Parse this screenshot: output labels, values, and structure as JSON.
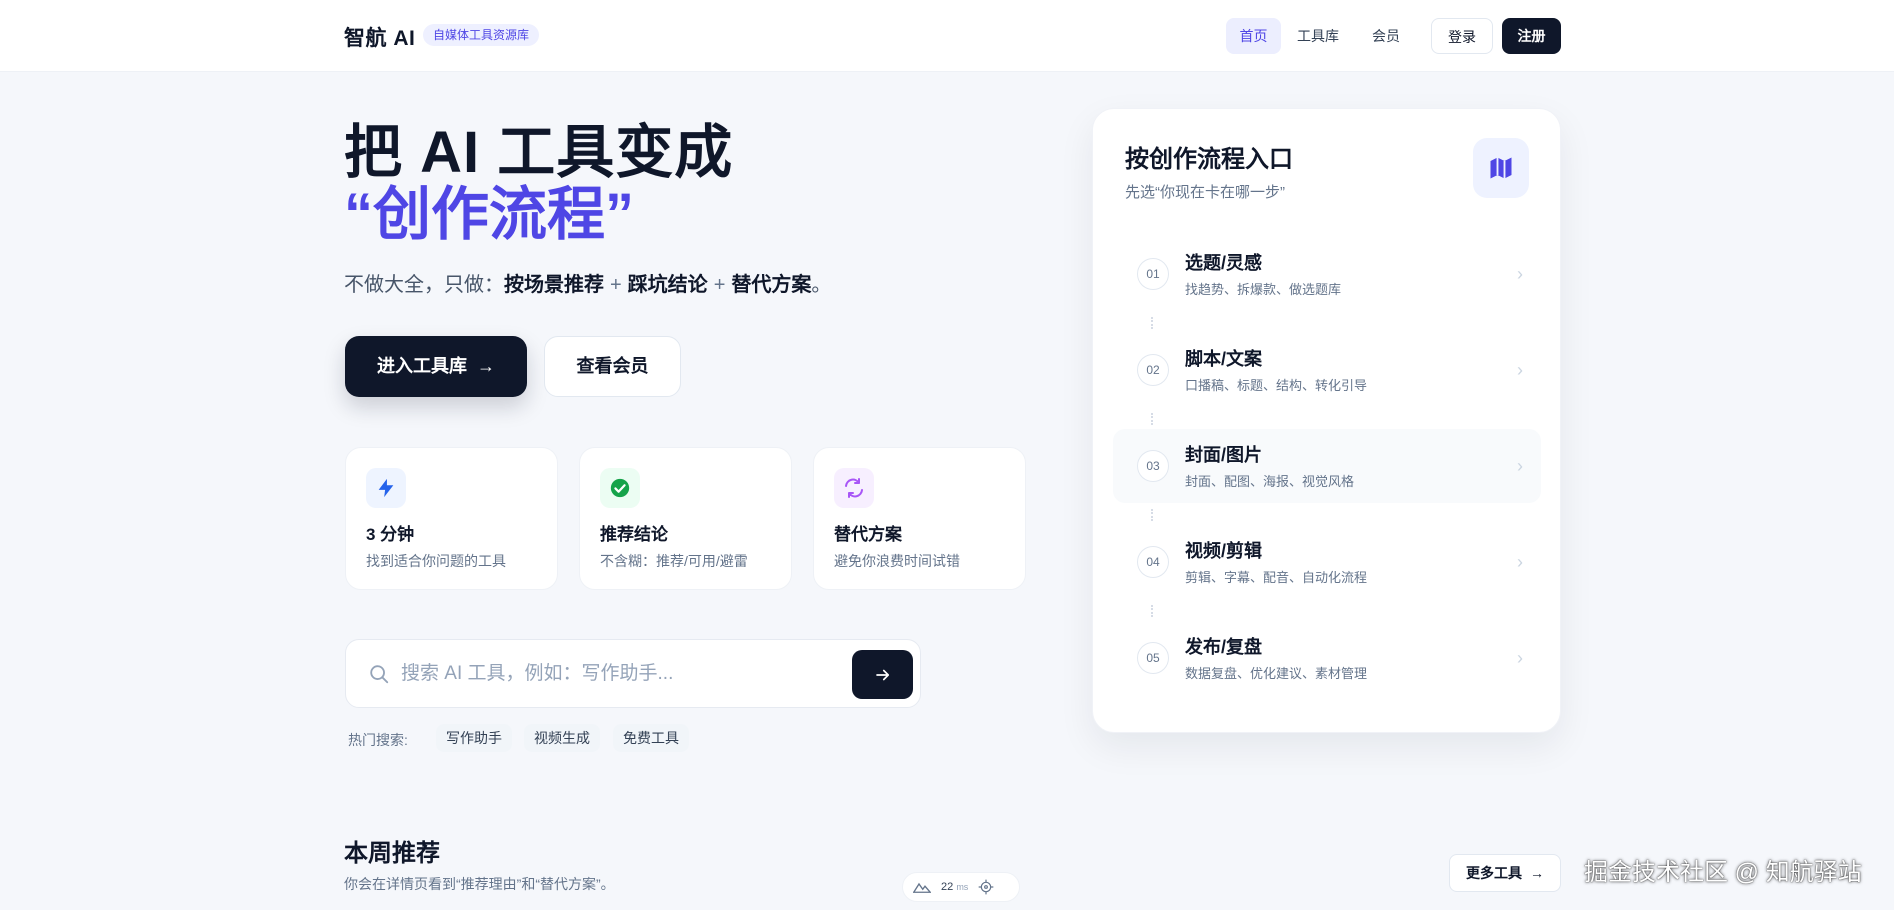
{
  "header": {
    "brand": "智航 AI",
    "badge": "自媒体工具资源库",
    "nav": [
      "首页",
      "工具库",
      "会员"
    ],
    "login": "登录",
    "register": "注册"
  },
  "hero": {
    "line1": "把 AI 工具变成",
    "line2": "“创作流程”",
    "subtitle_lead": "不做大全，只做：",
    "subtitle_items": [
      "按场景推荐",
      "踩坑结论",
      "替代方案"
    ],
    "subtitle_plus": "+",
    "subtitle_end": "。",
    "primary_button": "进入工具库",
    "primary_arrow": "→",
    "secondary_button": "查看会员"
  },
  "features": [
    {
      "title": "3 分钟",
      "desc": "找到适合你问题的工具",
      "icon": "bolt-icon",
      "color": "#2563eb"
    },
    {
      "title": "推荐结论",
      "desc": "不含糊：推荐/可用/避雷",
      "icon": "check-circle-icon",
      "color": "#16a34a"
    },
    {
      "title": "替代方案",
      "desc": "避免你浪费时间试错",
      "icon": "swap-icon",
      "color": "#a855f7"
    }
  ],
  "search": {
    "placeholder": "搜索 AI 工具，例如：写作助手...",
    "hot_label": "热门搜索:",
    "hot_items": [
      "写作助手",
      "视频生成",
      "免费工具"
    ]
  },
  "panel": {
    "title": "按创作流程入口",
    "subtitle": "先选“你现在卡在哪一步”",
    "steps": [
      {
        "num": "01",
        "title": "选题/灵感",
        "desc": "找趋势、拆爆款、做选题库"
      },
      {
        "num": "02",
        "title": "脚本/文案",
        "desc": "口播稿、标题、结构、转化引导"
      },
      {
        "num": "03",
        "title": "封面/图片",
        "desc": "封面、配图、海报、视觉风格"
      },
      {
        "num": "04",
        "title": "视频/剪辑",
        "desc": "剪辑、字幕、配音、自动化流程"
      },
      {
        "num": "05",
        "title": "发布/复盘",
        "desc": "数据复盘、优化建议、素材管理"
      }
    ]
  },
  "weekly": {
    "title": "本周推荐",
    "subtitle": "你会在详情页看到“推荐理由”和“替代方案”。",
    "more": "更多工具",
    "more_arrow": "→"
  },
  "perf": {
    "value": "22",
    "unit": "ms"
  },
  "watermark": "掘金技术社区 @ 知航驿站",
  "colors": {
    "accent": "#4f46e5",
    "dark": "#0f172a",
    "muted": "#64748b"
  }
}
